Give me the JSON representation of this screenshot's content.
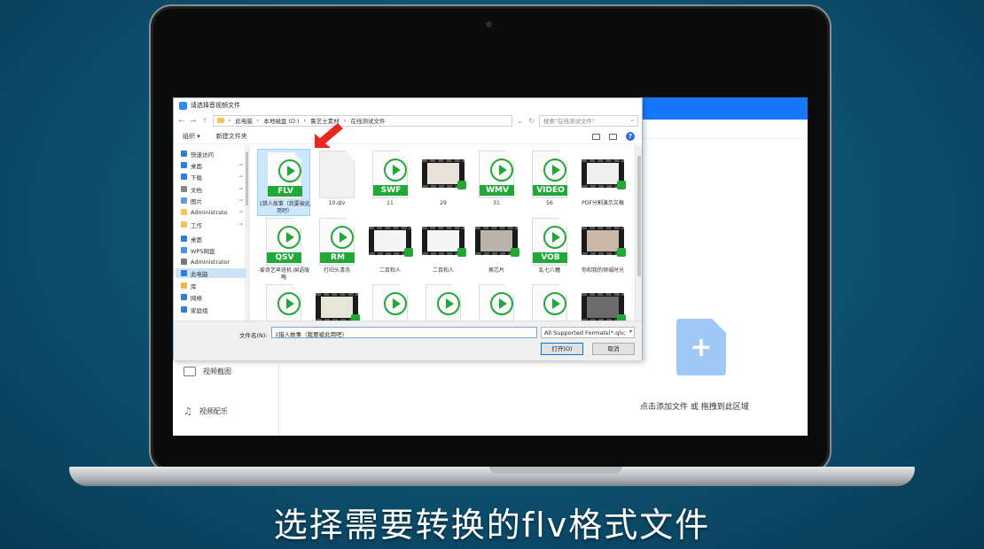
{
  "dialog": {
    "title": "请选择音视频文件",
    "breadcrumb": [
      "此电脑",
      "本地磁盘 (D:)",
      "鲁艺士素材",
      "在线测试文件"
    ],
    "search_placeholder": "搜索\"在线测试文件\"",
    "toolbar": {
      "organize": "组织 ▾",
      "new_folder": "新建文件夹"
    },
    "nav_items": [
      {
        "label": "快速访问",
        "icon": "star-icon",
        "color": "#2d7fd8",
        "pinned": false,
        "selected": false
      },
      {
        "label": "桌面",
        "icon": "desktop-icon",
        "color": "#2d7fd8",
        "pinned": true,
        "selected": false
      },
      {
        "label": "下载",
        "icon": "download-icon",
        "color": "#2d7fd8",
        "pinned": true,
        "selected": false
      },
      {
        "label": "文档",
        "icon": "document-icon",
        "color": "#888888",
        "pinned": true,
        "selected": false
      },
      {
        "label": "图片",
        "icon": "pictures-icon",
        "color": "#6a9bd1",
        "pinned": true,
        "selected": false
      },
      {
        "label": "Administrato",
        "icon": "folder-icon",
        "color": "#f3c55b",
        "pinned": true,
        "selected": false
      },
      {
        "label": "工作",
        "icon": "folder-icon",
        "color": "#f3c55b",
        "pinned": true,
        "selected": false
      },
      {
        "label": "桌面",
        "icon": "desktop-icon",
        "color": "#2d7fd8",
        "pinned": false,
        "selected": false
      },
      {
        "label": "WPS网盘",
        "icon": "cloud-icon",
        "color": "#4a90e2",
        "pinned": false,
        "selected": false
      },
      {
        "label": "Administrator",
        "icon": "user-icon",
        "color": "#777777",
        "pinned": false,
        "selected": false
      },
      {
        "label": "此电脑",
        "icon": "computer-icon",
        "color": "#2d7fd8",
        "pinned": false,
        "selected": true
      },
      {
        "label": "库",
        "icon": "library-icon",
        "color": "#e8b84a",
        "pinned": false,
        "selected": false
      },
      {
        "label": "网络",
        "icon": "network-icon",
        "color": "#2d7fd8",
        "pinned": false,
        "selected": false
      },
      {
        "label": "家庭组",
        "icon": "homegroup-icon",
        "color": "#2d7fd8",
        "pinned": false,
        "selected": false
      }
    ],
    "files": [
      {
        "kind": "badge",
        "badge": "FLV",
        "label": "1猎人故事（我要被此用吧）",
        "selected": true
      },
      {
        "kind": "blank",
        "badge": "",
        "label": "10.qlv",
        "selected": false
      },
      {
        "kind": "badge",
        "badge": "SWF",
        "label": "11",
        "selected": false
      },
      {
        "kind": "film",
        "badge": "",
        "label": "29",
        "frame_color": "#e9e2da",
        "selected": false
      },
      {
        "kind": "badge",
        "badge": "WMV",
        "label": "31",
        "selected": false
      },
      {
        "kind": "badge",
        "badge": "VIDEO",
        "label": "56",
        "selected": false
      },
      {
        "kind": "film",
        "badge": "",
        "label": "PDF分割演示文稿",
        "frame_color": "#eeeeee",
        "selected": false
      },
      {
        "kind": "badge",
        "badge": "QSV",
        "label": "-爱奇艺早班机-国语版略",
        "selected": false
      },
      {
        "kind": "badge",
        "badge": "RM",
        "label": "打印头清洗",
        "selected": false
      },
      {
        "kind": "film",
        "badge": "",
        "label": "二百和人",
        "frame_color": "#f4f4f4",
        "selected": false
      },
      {
        "kind": "film",
        "badge": "",
        "label": "二百和人",
        "frame_color": "#f4f4f4",
        "selected": false
      },
      {
        "kind": "film",
        "badge": "",
        "label": "换芯片",
        "frame_color": "#b9b3aa",
        "selected": false
      },
      {
        "kind": "badge",
        "badge": "VOB",
        "label": "乱七八糟",
        "selected": false
      },
      {
        "kind": "film",
        "badge": "",
        "label": "你和我的倾城时光",
        "frame_color": "#cbb8a6",
        "selected": false
      },
      {
        "kind": "badge",
        "badge": "",
        "label": "",
        "selected": false
      },
      {
        "kind": "film",
        "badge": "",
        "label": "",
        "frame_color": "#e6e6d8",
        "selected": false
      },
      {
        "kind": "badge",
        "badge": "",
        "label": "",
        "selected": false
      },
      {
        "kind": "badge",
        "badge": "",
        "label": "",
        "selected": false
      },
      {
        "kind": "badge",
        "badge": "",
        "label": "",
        "selected": false
      },
      {
        "kind": "badge",
        "badge": "",
        "label": "",
        "selected": false
      },
      {
        "kind": "film",
        "badge": "",
        "label": "",
        "frame_color": "#6c6c6c",
        "selected": false
      }
    ],
    "footer": {
      "filename_label": "文件名(N):",
      "filename_value": "1猎人故事（我要被此用吧）",
      "format_value": "All Supported Formats(*.qlv;",
      "open_button": "打开(O)",
      "cancel_button": "取消"
    }
  },
  "app": {
    "sidebar": [
      {
        "label": "视频截图",
        "icon": "screenshot-icon"
      },
      {
        "label": "视频配乐",
        "icon": "music-icon"
      }
    ],
    "add_icon_glyph": "+",
    "drop_hint": "点击添加文件 或 拖拽到此区域",
    "accent": "#1677ff"
  },
  "caption": "选择需要转换的flv格式文件"
}
